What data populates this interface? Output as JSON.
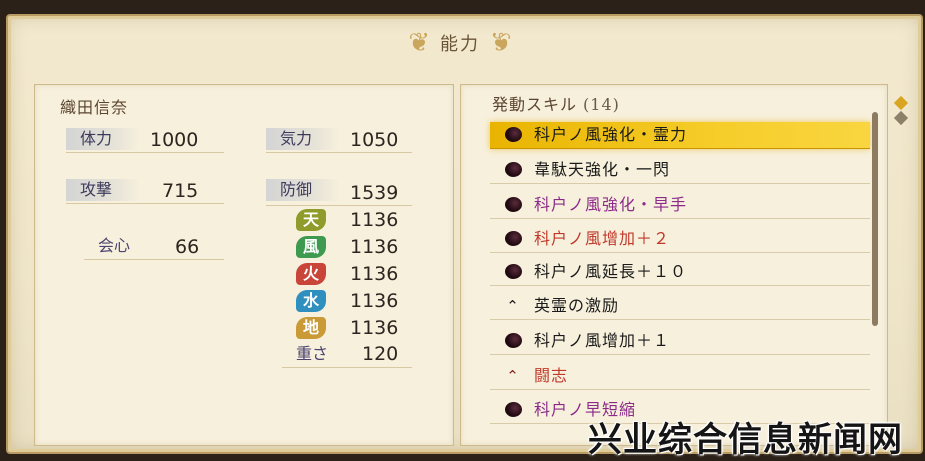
{
  "panel_title": "能力",
  "character": {
    "name": "織田信奈"
  },
  "stats": {
    "hp": {
      "label": "体力",
      "value": "1000"
    },
    "ki": {
      "label": "気力",
      "value": "1050"
    },
    "attack": {
      "label": "攻撃",
      "value": "715"
    },
    "defense": {
      "label": "防御",
      "value": "1539"
    },
    "critical": {
      "label": "会心",
      "value": "66"
    },
    "weight": {
      "label": "重さ",
      "value": "120"
    }
  },
  "elements": [
    {
      "label": "天",
      "value": "1136",
      "color": "#8f9b2a"
    },
    {
      "label": "風",
      "value": "1136",
      "color": "#3e9a4e"
    },
    {
      "label": "火",
      "value": "1136",
      "color": "#c9453a"
    },
    {
      "label": "水",
      "value": "1136",
      "color": "#2f8fbf"
    },
    {
      "label": "地",
      "value": "1136",
      "color": "#c99a36"
    }
  ],
  "skills": {
    "header": "発動スキル",
    "count": "(14)",
    "items": [
      {
        "label": "科户ノ風強化・霊力",
        "icon": "dark-orb-icon",
        "color": "#1a1a1a",
        "selected": true
      },
      {
        "label": "韋駄天強化・一閃",
        "icon": "dark-orb-icon",
        "color": "#1a1a1a",
        "selected": false
      },
      {
        "label": "科户ノ風強化・早手",
        "icon": "dark-orb-icon",
        "color": "#8c2a8a",
        "selected": false
      },
      {
        "label": "科户ノ風增加＋２",
        "icon": "dark-orb-icon",
        "color": "#c0392b",
        "selected": false
      },
      {
        "label": "科户ノ風延長＋１０",
        "icon": "dark-orb-icon",
        "color": "#1a1a1a",
        "selected": false
      },
      {
        "label": "英霊の激励",
        "icon": "chevron-up-icon",
        "color": "#1a1a1a",
        "selected": false
      },
      {
        "label": "科户ノ風增加＋１",
        "icon": "dark-orb-icon",
        "color": "#1a1a1a",
        "selected": false
      },
      {
        "label": "闘志",
        "icon": "chevron-up-icon",
        "color": "#c0392b",
        "selected": false
      },
      {
        "label": "科户ノ早短縮",
        "icon": "dark-orb-icon",
        "color": "#8c2a8a",
        "selected": false
      }
    ]
  },
  "watermark": "兴业综合信息新闻网"
}
